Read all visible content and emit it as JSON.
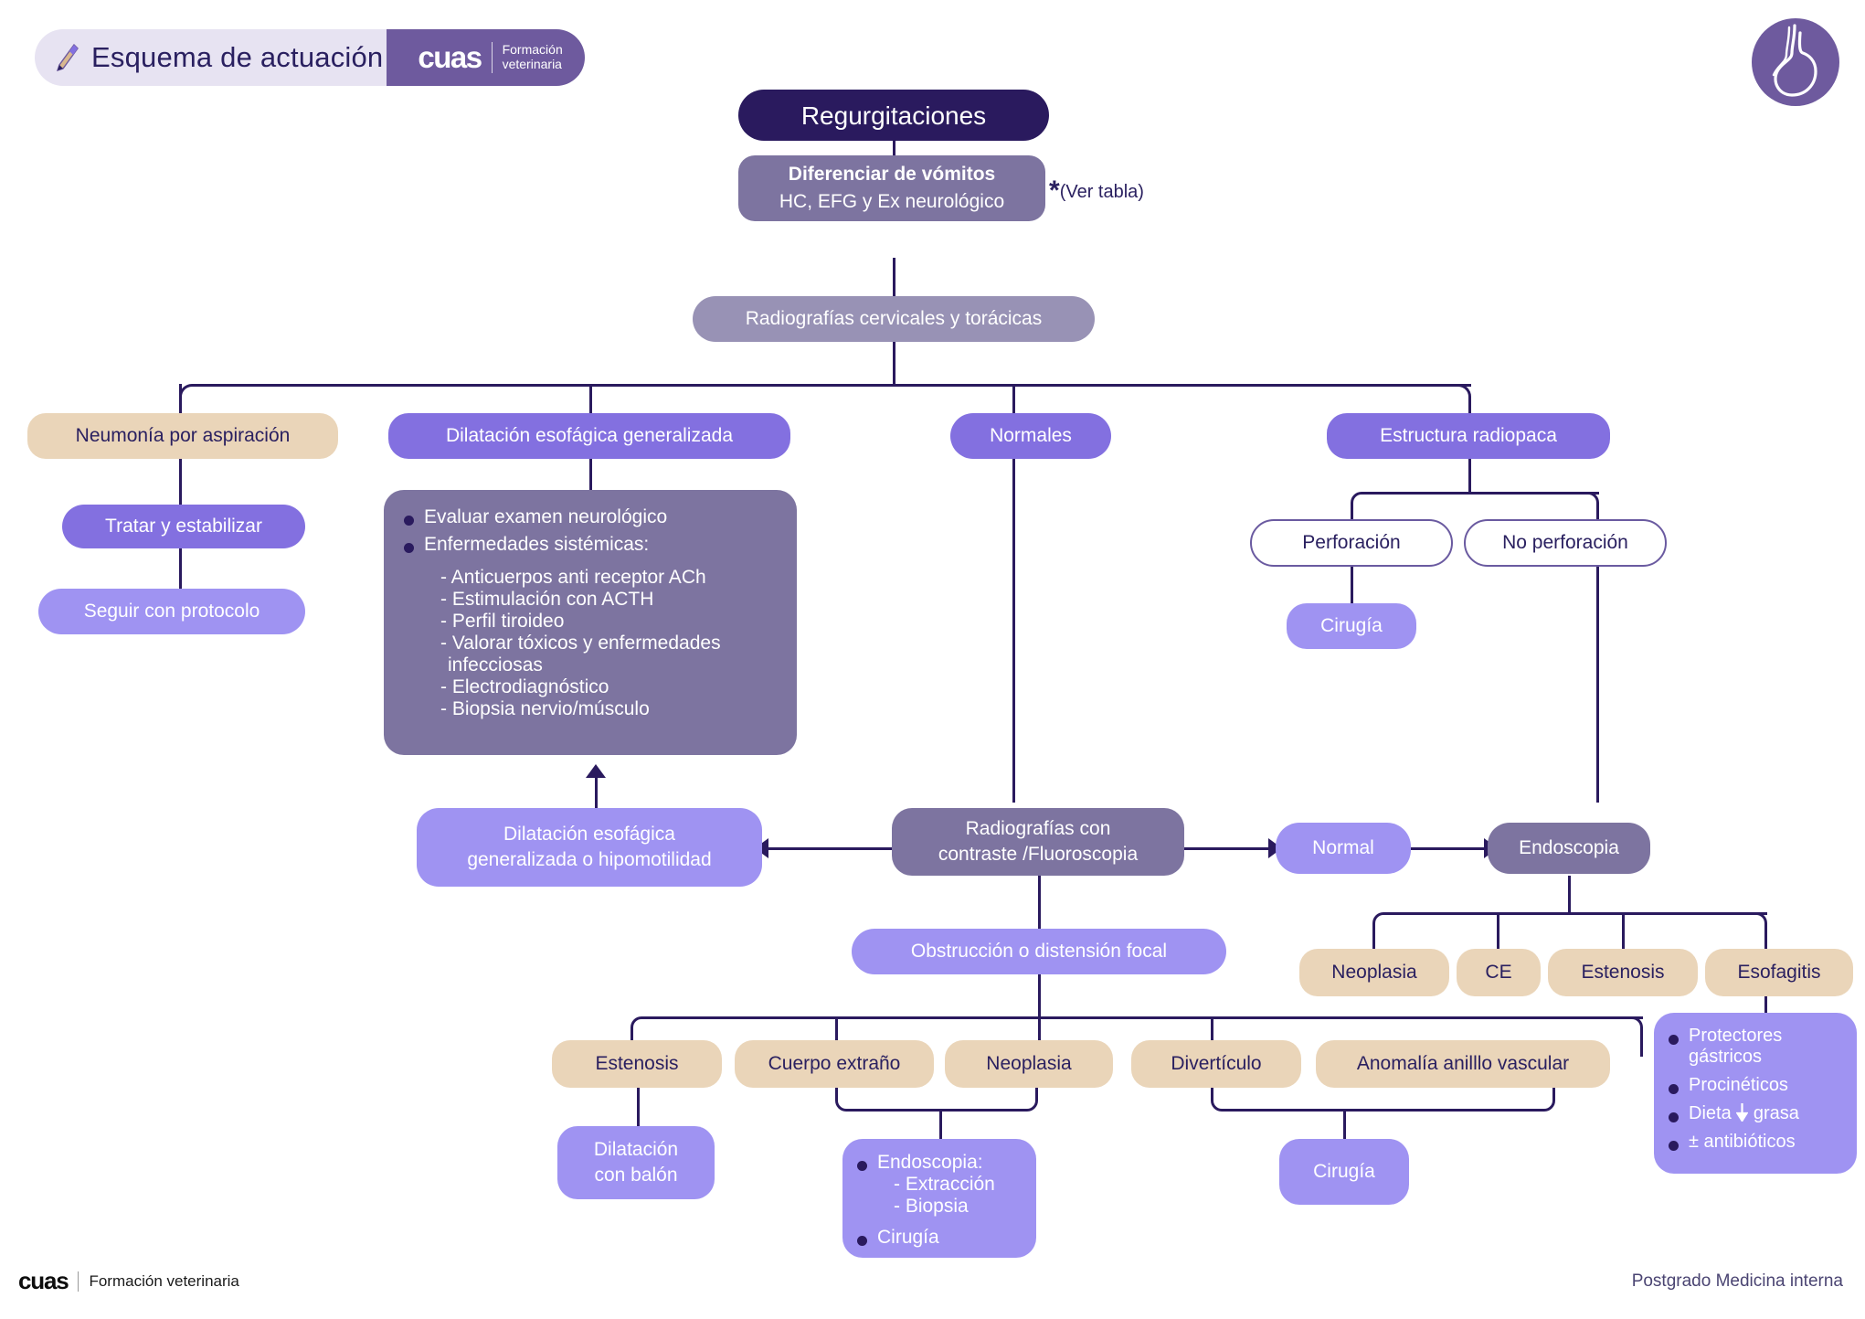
{
  "header": {
    "title": "Esquema de actuación",
    "logo": "cuas",
    "logo_sub_line1": "Formación",
    "logo_sub_line2": "veterinaria",
    "pencil_icon": "pencil-icon",
    "badge_icon": "stomach-icon",
    "colors": {
      "header_left_bg": "#e7e3f2",
      "header_right_bg": "#6e5a9e",
      "title_text": "#2a2060"
    }
  },
  "footer": {
    "logo": "cuas",
    "logo_sub": "Formación veterinaria",
    "right_text": "Postgrado Medicina interna"
  },
  "palette": {
    "dark_navy": "#2a1a5e",
    "grey_purple": "#7d74a0",
    "grey_purple_light": "#9892b5",
    "purple": "#8370e0",
    "light_purple": "#9f93f2",
    "tan": "#ead5b9",
    "white_outline": "#6a5aa0",
    "connector": "#2a1a5e"
  },
  "nodes": {
    "root": "Regurgitaciones",
    "differentiate_title": "Diferenciar de vómitos",
    "differentiate_sub": "HC, EFG y Ex neurológico",
    "see_table_star": "*",
    "see_table_text": "(Ver tabla)",
    "radiographs": "Radiografías cervicales y torácicas",
    "aspiration_pneumonia": "Neumonía por aspiración",
    "treat_stabilize": "Tratar y estabilizar",
    "follow_protocol": "Seguir con protocolo",
    "generalized_dilation": "Dilatación esofágica generalizada",
    "normales": "Normales",
    "radiopaque_structure": "Estructura radiopaca",
    "perforation": "Perforación",
    "no_perforation": "No perforación",
    "surgery_perf": "Cirugía",
    "contrast_radiographs_l1": "Radiografías con",
    "contrast_radiographs_l2": "contraste /Fluoroscopia",
    "dilation_or_hypomotility_l1": "Dilatación esofágica",
    "dilation_or_hypomotility_l2": "generalizada o hipomotilidad",
    "normal": "Normal",
    "endoscopy": "Endoscopia",
    "focal_obstruction": "Obstrucción o distensión focal",
    "endo_neoplasia": "Neoplasia",
    "endo_ce": "CE",
    "endo_estenosis": "Estenosis",
    "endo_esofagitis": "Esofagitis",
    "obs_estenosis": "Estenosis",
    "obs_cuerpo_extrano": "Cuerpo extraño",
    "obs_neoplasia": "Neoplasia",
    "obs_diverticulo": "Divertículo",
    "obs_anillo_vascular": "Anomalía anilllo vascular",
    "balloon_dilation_l1": "Dilatación",
    "balloon_dilation_l2": "con balón",
    "surgery_ring": "Cirugía"
  },
  "neuro_box": {
    "items": [
      {
        "type": "bullet",
        "text": "Evaluar examen neurológico"
      },
      {
        "type": "bullet",
        "text": "Enfermedades sistémicas:"
      },
      {
        "type": "dash",
        "text": "- Anticuerpos anti receptor ACh"
      },
      {
        "type": "dash",
        "text": "- Estimulación con ACTH"
      },
      {
        "type": "dash",
        "text": "- Perfil tiroideo"
      },
      {
        "type": "dash",
        "text": "- Valorar tóxicos y enfermedades"
      },
      {
        "type": "cont",
        "text": "infecciosas"
      },
      {
        "type": "dash",
        "text": "- Electrodiagnóstico"
      },
      {
        "type": "dash",
        "text": "- Biopsia nervio/músculo"
      }
    ]
  },
  "endoscopy_box": {
    "items": [
      {
        "type": "bullet",
        "text": "Endoscopia:"
      },
      {
        "type": "dash",
        "text": "- Extracción"
      },
      {
        "type": "dash",
        "text": "- Biopsia"
      },
      {
        "type": "bullet",
        "text": "Cirugía"
      }
    ]
  },
  "esophagitis_box": {
    "items": [
      {
        "type": "bullet",
        "text": "Protectores"
      },
      {
        "type": "cont",
        "text": "gástricos"
      },
      {
        "type": "bullet",
        "text": "Procinéticos"
      },
      {
        "type": "bullet_arrow",
        "pre": "Dieta",
        "icon": "down-arrow-icon",
        "post": "grasa"
      },
      {
        "type": "bullet",
        "text": "± antibióticos"
      }
    ]
  }
}
